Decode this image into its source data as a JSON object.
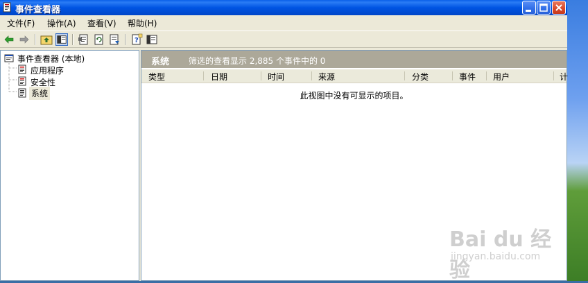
{
  "window": {
    "title": "事件查看器"
  },
  "menu": [
    {
      "label": "文件(F)"
    },
    {
      "label": "操作(A)"
    },
    {
      "label": "查看(V)"
    },
    {
      "label": "帮助(H)"
    }
  ],
  "tree": {
    "root": "事件查看器 (本地)",
    "items": [
      {
        "label": "应用程序"
      },
      {
        "label": "安全性"
      },
      {
        "label": "系统"
      }
    ]
  },
  "details": {
    "title": "系统",
    "summary": "筛选的查看显示 2,885 个事件中的 0",
    "columns": [
      "类型",
      "日期",
      "时间",
      "来源",
      "分类",
      "事件",
      "用户",
      "计"
    ],
    "empty_message": "此视图中没有可显示的项目。"
  },
  "watermark": {
    "brand": "Bai du 经验",
    "url": "jingyan.baidu.com"
  },
  "colors": {
    "titlebar": "#0054e3",
    "details_header": "#aca899",
    "selection": "#ece9d8"
  }
}
